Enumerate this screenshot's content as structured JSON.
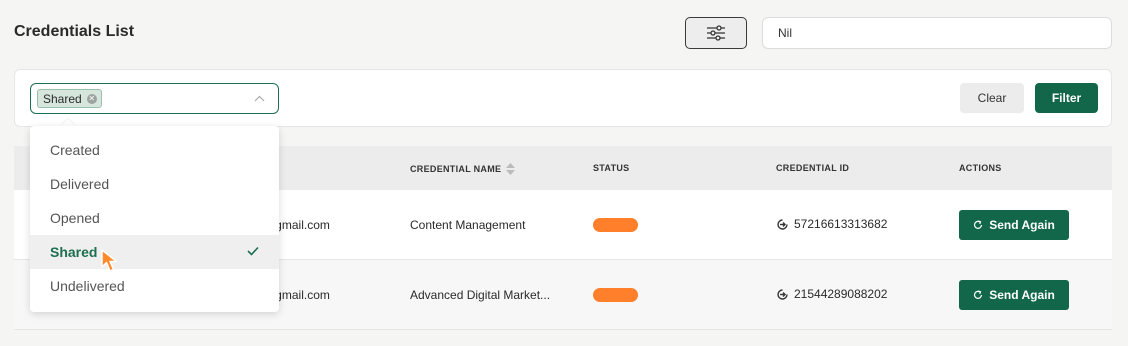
{
  "header": {
    "title": "Credentials List",
    "filter_toggle_icon": "sliders-icon"
  },
  "search": {
    "value": "Nil",
    "placeholder": ""
  },
  "filter": {
    "selected_tag": "Shared",
    "clear_label": "Clear",
    "filter_label": "Filter",
    "options": [
      {
        "label": "Created",
        "selected": false
      },
      {
        "label": "Delivered",
        "selected": false
      },
      {
        "label": "Opened",
        "selected": false
      },
      {
        "label": "Shared",
        "selected": true
      },
      {
        "label": "Undelivered",
        "selected": false
      }
    ]
  },
  "table": {
    "columns": {
      "name": "CREDENTIAL NAME",
      "status": "STATUS",
      "id": "CREDENTIAL ID",
      "actions": "ACTIONS"
    },
    "rows": [
      {
        "email": "@gmail.com",
        "credential_name": "Content Management",
        "status_color": "#ff7f2a",
        "credential_id": "57216613313682",
        "action": "Send Again"
      },
      {
        "email": "@gmail.com",
        "credential_name": "Advanced Digital Market...",
        "status_color": "#ff7f2a",
        "credential_id": "21544289088202",
        "action": "Send Again"
      }
    ]
  },
  "colors": {
    "accent": "#12664a",
    "status": "#ff7f2a"
  }
}
